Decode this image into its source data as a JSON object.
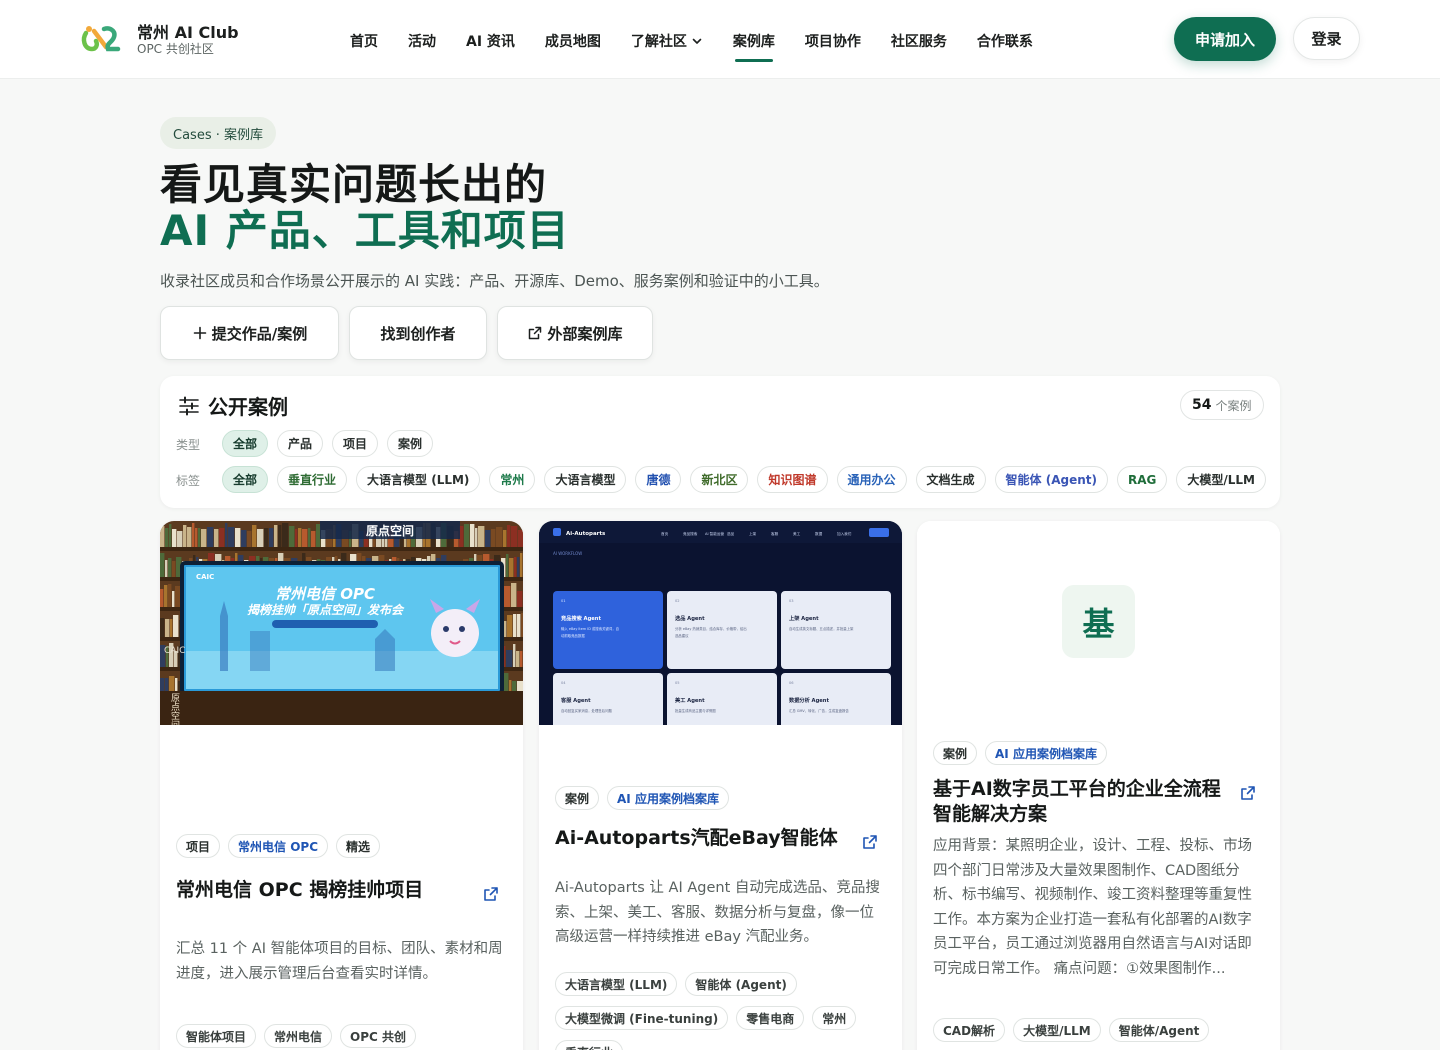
{
  "brand": {
    "title": "常州 AI Club",
    "subtitle": "OPC 共创社区"
  },
  "nav": {
    "items": [
      "首页",
      "活动",
      "AI 资讯",
      "成员地图",
      "了解社区",
      "案例库",
      "项目协作",
      "社区服务",
      "合作联系"
    ],
    "active": "案例库"
  },
  "header_actions": {
    "join": "申请加入",
    "login": "登录"
  },
  "hero": {
    "pill": "Cases · 案例库",
    "title_line1": "看见真实问题长出的",
    "title_line2": "AI 产品、工具和项目",
    "description": "收录社区成员和合作场景公开展示的 AI 实践：产品、开源库、Demo、服务案例和验证中的小工具。",
    "buttons": {
      "submit": "提交作品/案例",
      "find": "找到创作者",
      "external": "外部案例库"
    }
  },
  "filter": {
    "title": "公开案例",
    "count": "54",
    "count_unit": "个案例",
    "type_label": "类型",
    "types": [
      "全部",
      "产品",
      "项目",
      "案例"
    ],
    "tag_label": "标签",
    "tags": [
      "全部",
      "垂直行业",
      "大语言模型 (LLM)",
      "常州",
      "大语言模型",
      "唐德",
      "新北区",
      "知识图谱",
      "通用办公",
      "文档生成",
      "智能体 (Agent)",
      "RAG",
      "大模型/LLM"
    ],
    "tag_colors": {
      "垂直行业": "#2e6b33",
      "常州": "#1d7a4a",
      "唐德": "#2251b0",
      "新北区": "#3f6b2a",
      "知识图谱": "#c0392b",
      "通用办公": "#2a63b8",
      "智能体 (Agent)": "#3a55b5",
      "RAG": "#1f6d3a"
    }
  },
  "cards": [
    {
      "image": {
        "screen_title": "常州电信 OPC",
        "screen_sub": "揭榜挂帅「原点空间」发布会",
        "brand": "CAIC",
        "vertical": "原点空间",
        "banner": "原点空间"
      },
      "tags": [
        "项目",
        "常州电信 OPC",
        "精选"
      ],
      "title": "常州电信 OPC 揭榜挂帅项目",
      "description": "汇总 11 个 AI 智能体项目的目标、团队、素材和周进度，进入展示管理后台查看实时详情。",
      "keywords": [
        "智能体项目",
        "常州电信",
        "OPC 共创"
      ]
    },
    {
      "image": {
        "app": "Ai-Autoparts",
        "nav": [
          "首页",
          "竞品搜索",
          "AI 智能运营",
          "选品",
          "上架",
          "客服",
          "美工",
          "数据",
          "加入我们"
        ],
        "section": "AI WORKFLOW",
        "tiles": [
          {
            "num": "01",
            "name": "竞品搜索 Agent",
            "text": "输入 eBay Item ID 或搜索关键词，自动抓取竞品数据"
          },
          {
            "num": "02",
            "name": "选品 Agent",
            "text": "分析 eBay 热销类目，结合库存、价格带，给出选品建议"
          },
          {
            "num": "03",
            "name": "上架 Agent",
            "text": "自动生成英文标题、五点描述，并批量上架"
          },
          {
            "num": "04",
            "name": "客服 Agent",
            "text": "自动回复买家消息，处理售后问题"
          },
          {
            "num": "05",
            "name": "美工 Agent",
            "text": "批量生成商品主图与详情图"
          },
          {
            "num": "06",
            "name": "数据分析 Agent",
            "text": "汇总 GMV、转化、广告，生成复盘报告"
          }
        ]
      },
      "tags": [
        "案例",
        "AI 应用案例档案库"
      ],
      "title": "Ai-Autoparts汽配eBay智能体",
      "description": "Ai-Autoparts 让 AI Agent 自动完成选品、竞品搜索、上架、美工、客服、数据分析与复盘，像一位高级运营一样持续推进 eBay 汽配业务。",
      "keywords": [
        "大语言模型 (LLM)",
        "智能体 (Agent)",
        "大模型微调 (Fine-tuning)",
        "零售电商",
        "常州",
        "垂直行业"
      ]
    },
    {
      "image": {
        "glyph": "基"
      },
      "tags": [
        "案例",
        "AI 应用案例档案库"
      ],
      "title": "基于AI数字员工平台的企业全流程智能解决方案",
      "description": "应用背景：某照明企业，设计、工程、投标、市场四个部门日常涉及大量效果图制作、CAD图纸分析、标书编写、视频制作、竣工资料整理等重复性工作。本方案为企业打造一套私有化部署的AI数字员工平台，员工通过浏览器用自然语言与AI对话即可完成日常工作。 痛点问题：①效果图制作...",
      "keywords": [
        "CAD解析",
        "大模型/LLM",
        "智能体/Agent"
      ]
    }
  ],
  "colors": {
    "accent": "#0f6e52",
    "link_blue": "#1f55b4"
  }
}
